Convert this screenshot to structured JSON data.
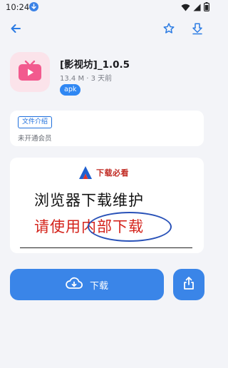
{
  "status_bar": {
    "time": "10:24"
  },
  "top_bar": {
    "icons": [
      "back-arrow-icon",
      "star-icon",
      "download-arrow-icon"
    ]
  },
  "app": {
    "title": "[影视坊]_1.0.5",
    "meta": "13.4 M · 3 天前",
    "tag": "apk",
    "icon": "video-play-icon"
  },
  "info_card": {
    "chip_label": "文件介绍",
    "subtitle": "未开通会员"
  },
  "banner": {
    "brand": "下载必看",
    "line1": "浏览器下载维护",
    "line2": "请使用内部下载"
  },
  "actions": {
    "download_label": "下载",
    "download_icon": "cloud-download-icon",
    "share_icon": "share-icon"
  },
  "colors": {
    "accent": "#3a85e8",
    "background": "#f3f4f8",
    "banner_red": "#d4231b",
    "app_icon_pink": "#f25a8e"
  }
}
